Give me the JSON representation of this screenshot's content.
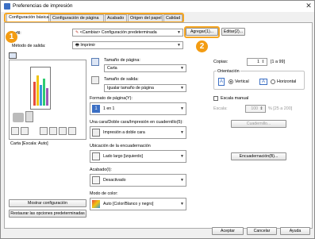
{
  "window": {
    "title": "Preferencias de impresión",
    "close": "✕"
  },
  "tabs": [
    {
      "label": "Configuración básica"
    },
    {
      "label": "Configuración de página"
    },
    {
      "label": "Acabado"
    },
    {
      "label": "Origen del papel"
    },
    {
      "label": "Calidad"
    }
  ],
  "profile": {
    "label": "Perfil:",
    "value": "<Cambiar> Configuración predeterminada",
    "add_button": "Agregar(1)...",
    "edit_button": "Editar(2)..."
  },
  "output_method": {
    "label": "Método de salida:",
    "value": "Imprimir"
  },
  "badges": {
    "one": "1",
    "two": "2"
  },
  "preview": {
    "caption": "Carta [Escala: Auto]"
  },
  "left_buttons": {
    "show_settings": "Mostrar configuración",
    "restore_defaults": "Restaurar las opciones predeterminadas"
  },
  "page_size": {
    "label": "Tamaño de página:",
    "value": "Carta"
  },
  "output_size": {
    "label": "Tamaño de salida:",
    "value": "Igualar tamaño de página"
  },
  "copies": {
    "label": "Copias:",
    "value": "1",
    "range": "[1 a 99]"
  },
  "orientation": {
    "label": "Orientación",
    "vertical": "Vertical",
    "horizontal": "Horizontal",
    "selected": "vertical"
  },
  "page_layout": {
    "label": "Formato de página(Y):",
    "value": "1 en 1"
  },
  "manual_scaling": {
    "label": "Escala manual",
    "scale_label": "Escala:",
    "scale_value": "100",
    "scale_range": "% [25 a 200]"
  },
  "duplex": {
    "label": "Una cara/Doble cara/Impresión en cuadernillo(5):",
    "value": "Impresión a doble cara",
    "booklet_button": "Cuadernillo..."
  },
  "binding": {
    "label": "Ubicación de la encuadernación",
    "value": "Lado largo [izquierdo]",
    "button": "Encuadernación(B)..."
  },
  "finishing": {
    "label": "Acabado(I):",
    "value": "Desactivado"
  },
  "color_mode": {
    "label": "Modo de color:",
    "value": "Auto [Color/Blanco y negro]"
  },
  "footer": {
    "ok": "Aceptar",
    "cancel": "Cancelar",
    "help": "Ayuda"
  },
  "colors": {
    "highlight": "#f5a623",
    "badge": "#f39c12"
  }
}
